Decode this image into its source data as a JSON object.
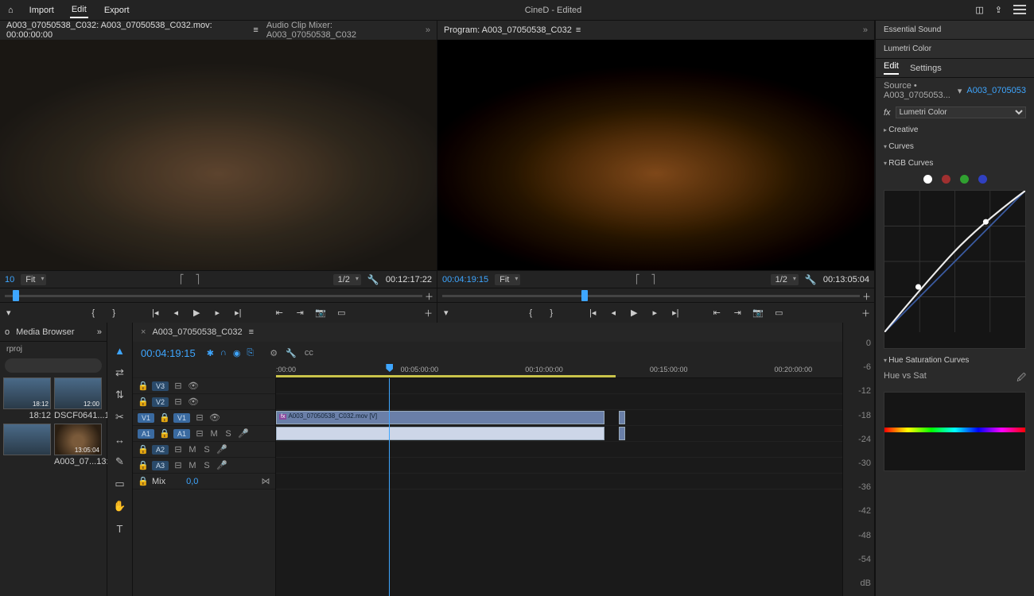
{
  "topbar": {
    "home_icon": "⌂",
    "menu": {
      "import": "Import",
      "edit": "Edit",
      "export": "Export"
    },
    "title": "CineD - Edited",
    "right_icons": [
      "workspace-icon",
      "share-icon",
      "menu-icon"
    ]
  },
  "source_monitor": {
    "tab_source": "A003_07050538_C032: A003_07050538_C032.mov: 00:00:00:00",
    "tab_audio_mixer": "Audio Clip Mixer: A003_07050538_C032",
    "timecode_left": "10",
    "fit_label": "Fit",
    "half_label": "1/2",
    "timecode_right": "00:12:17:22",
    "playhead_pct": 3
  },
  "program_monitor": {
    "tab_program": "Program: A003_07050538_C032",
    "timecode_left": "00:04:19:15",
    "fit_label": "Fit",
    "half_label": "1/2",
    "timecode_right": "00:13:05:04",
    "playhead_pct": 33
  },
  "transport_icons": [
    "▾",
    "⎙",
    "{",
    "}",
    "◂|",
    "◂",
    "▶",
    "▸",
    "|▸",
    "⇤",
    "⇥",
    "⎘",
    "⎚",
    "▭",
    "📷",
    "⎍"
  ],
  "project": {
    "tab_active_icon": "o",
    "tab_browser": "Media Browser",
    "proj_name": "rproj",
    "thumbs": [
      {
        "name": "",
        "dur": "18:12",
        "kind": "pool"
      },
      {
        "name": "DSCF0641...",
        "dur": "12:00",
        "kind": "pool"
      },
      {
        "name": "",
        "dur": "",
        "kind": "audio"
      },
      {
        "name": "A003_07...",
        "dur": "13:05:04",
        "kind": "pizza"
      }
    ]
  },
  "tools": [
    "▲",
    "⇄",
    "⇅",
    "✂",
    "↔",
    "✎",
    "▭",
    "✋",
    "T"
  ],
  "timeline": {
    "seq_name": "A003_07050538_C032",
    "timecode": "00:04:19:15",
    "ruler_ticks": [
      {
        "label": ":00:00",
        "pct": 0
      },
      {
        "label": "00:05:00:00",
        "pct": 22
      },
      {
        "label": "00:10:00:00",
        "pct": 44
      },
      {
        "label": "00:15:00:00",
        "pct": 66
      },
      {
        "label": "00:20:00:00",
        "pct": 88
      }
    ],
    "workarea": {
      "start_pct": 0,
      "end_pct": 60
    },
    "playhead_pct": 20,
    "video_tracks": [
      {
        "id": "V3",
        "sel": false
      },
      {
        "id": "V2",
        "sel": false
      },
      {
        "id": "V1",
        "sel": true
      }
    ],
    "audio_tracks": [
      {
        "id": "A1",
        "sel": true
      },
      {
        "id": "A2",
        "sel": false
      },
      {
        "id": "A3",
        "sel": false
      }
    ],
    "mix_label": "Mix",
    "mix_value": "0,0",
    "clip": {
      "name": "A003_07050538_C032.mov [V]",
      "start_pct": 0,
      "end_pct": 58
    },
    "tail_clip": {
      "start_pct": 60.5,
      "end_pct": 61.5
    }
  },
  "meter_scale": [
    "0",
    "-6",
    "-12",
    "-18",
    "-24",
    "-30",
    "-36",
    "-42",
    "-48",
    "-54",
    "dB"
  ],
  "lumetri": {
    "essential_sound": "Essential Sound",
    "title": "Lumetri Color",
    "tabs": {
      "edit": "Edit",
      "settings": "Settings"
    },
    "source_prefix": "Source • A003_0705053...",
    "source_link": "A003_0705053",
    "fx_label": "fx",
    "effect_name": "Lumetri Color",
    "sections": {
      "creative": "Creative",
      "curves": "Curves",
      "rgb_curves": "RGB Curves",
      "hue_sat": "Hue Saturation Curves",
      "hue_vs_sat": "Hue vs Sat"
    }
  }
}
